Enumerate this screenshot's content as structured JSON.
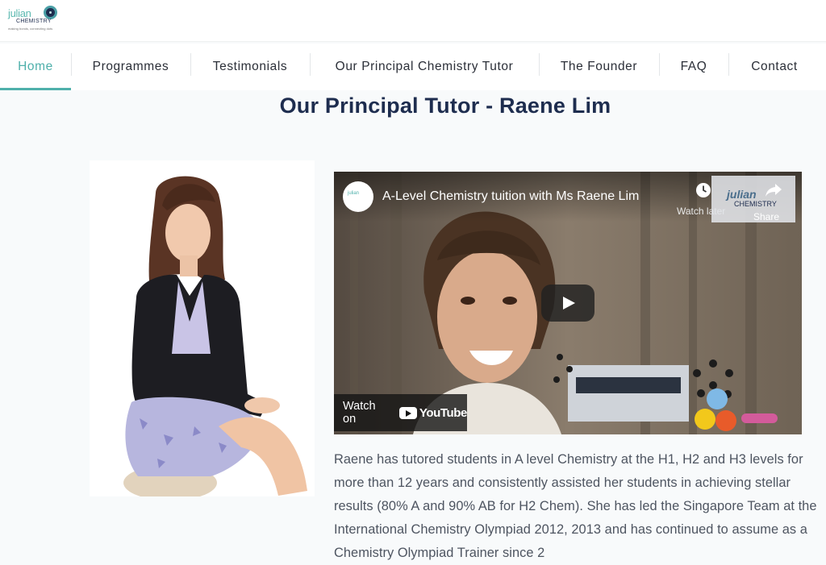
{
  "header": {
    "logo_text": "julian",
    "logo_sub": "CHEMISTRY",
    "logo_tagline": "making bonds, connecting dots"
  },
  "nav": {
    "items": [
      {
        "label": "Home",
        "active": true
      },
      {
        "label": "Programmes"
      },
      {
        "label": "Testimonials"
      },
      {
        "label": "Our Principal Chemistry Tutor"
      },
      {
        "label": "The Founder"
      },
      {
        "label": "FAQ"
      },
      {
        "label": "Contact"
      }
    ]
  },
  "page": {
    "title": "Our Principal Tutor - Raene Lim"
  },
  "video": {
    "title": "A-Level Chemistry tuition with Ms Raene Lim",
    "watch_later": "Watch later",
    "share": "Share",
    "share_logo": "julian",
    "share_logo_sub": "CHEMISTRY",
    "watch_on": "Watch on",
    "youtube": "YouTube",
    "channel_mini": "julian"
  },
  "bio": {
    "text": "Raene has tutored students in A level Chemistry at the H1, H2 and H3 levels for more than 12 years and consistently assisted her students in achieving stellar results (80% A and 90% AB for H2 Chem). She has led the Singapore Team at the International Chemistry Olympiad 2012, 2013 and has continued to assume as a Chemistry Olympiad Trainer since 2"
  },
  "colors": {
    "accent": "#4fb0ab",
    "title": "#1e2d4f",
    "body_text": "#4e5561"
  }
}
